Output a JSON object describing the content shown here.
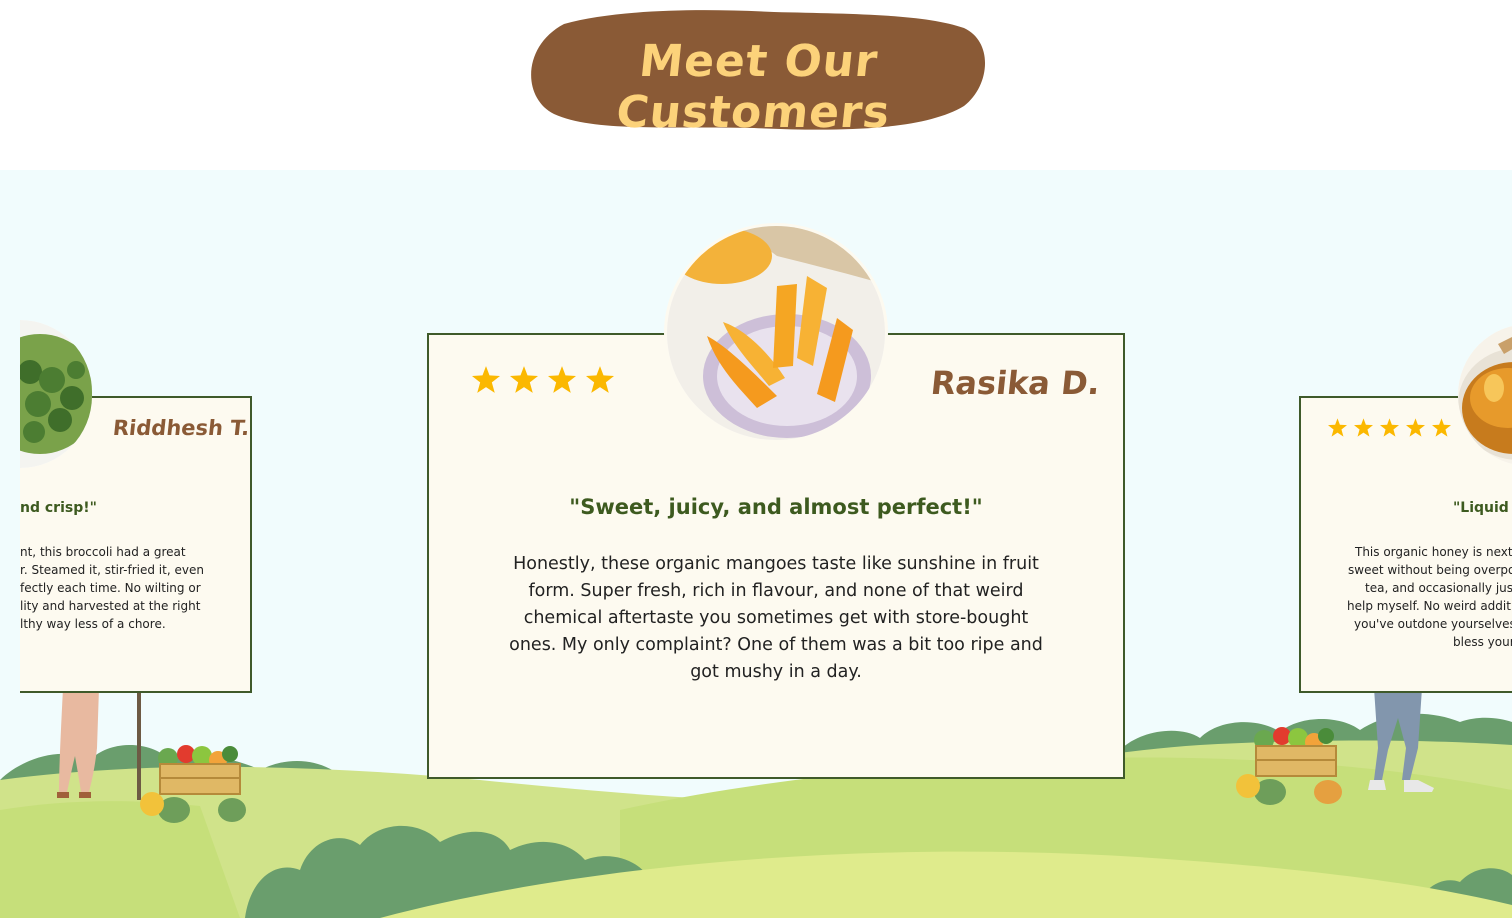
{
  "section": {
    "title": "Meet Our Customers",
    "blob_color": "#8a5a36",
    "title_color": "#fcd27a"
  },
  "colors": {
    "card_bg": "#fdfaf0",
    "card_border": "#3f5a2a",
    "star": "#fbb800",
    "name": "#8a5a36",
    "headline": "#3d5a1f",
    "sky": "#f1fcfd",
    "hill_light": "#d7e88f",
    "hill_mid": "#bcd872",
    "bush": "#6a9e6d"
  },
  "testimonials": {
    "left": {
      "name": "Riddhesh T.",
      "image": "broccoli-photo",
      "headline": "nd crisp!\"",
      "body": [
        "nt, this broccoli had a great",
        "r. Steamed it, stir-fried it, even",
        "fectly each time. No wilting or",
        "lity and harvested at the right",
        "lthy way less of a chore."
      ]
    },
    "main": {
      "name": "Rasika D.",
      "image": "mango-slices-photo",
      "rating": 4,
      "headline": "\"Sweet, juicy, and almost perfect!\"",
      "body": "Honestly, these organic mangoes taste like sunshine in fruit form. Super fresh, rich in flavour, and none of that weird chemical aftertaste you sometimes get with store-bought ones. My only complaint? One of them was a bit too ripe and got mushy in a day."
    },
    "right": {
      "image": "honey-jar-photo",
      "rating": 5,
      "headline": "\"Liquid g",
      "body": [
        "This organic honey is next-",
        "sweet without being overpo",
        "tea, and occasionally just",
        "help myself. No weird additi",
        "you've outdone yourselves",
        "bless your"
      ]
    }
  }
}
